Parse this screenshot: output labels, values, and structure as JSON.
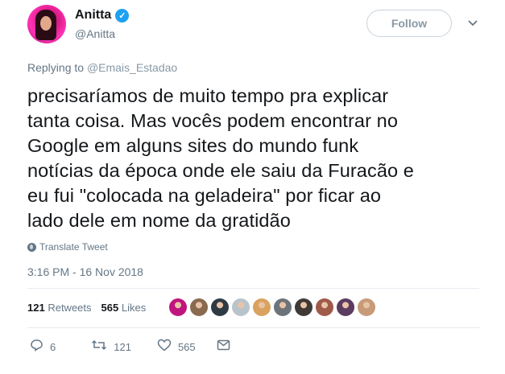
{
  "header": {
    "display_name": "Anitta",
    "handle": "@Anitta",
    "follow_label": "Follow"
  },
  "reply": {
    "prefix": "Replying to",
    "mention": "@Emais_Estadao"
  },
  "tweet": {
    "lines": [
      "precisaríamos de muito tempo pra explicar",
      "tanta coisa. Mas vocês podem encontrar no",
      "Google em alguns sites do mundo funk",
      "notícias da época onde ele saiu da Furacão e",
      "eu fui \"colocada na geladeira\" por ficar ao",
      "lado dele em nome da gratidão"
    ],
    "translate_label": "Translate Tweet",
    "timestamp": "3:16 PM - 16 Nov 2018"
  },
  "stats": {
    "retweets_count": "121",
    "retweets_label": "Retweets",
    "likes_count": "565",
    "likes_label": "Likes"
  },
  "actions": {
    "replies": "6",
    "retweets": "121",
    "likes": "565"
  },
  "colors": {
    "accent": "#1da1f2",
    "muted": "#657786",
    "text": "#14171a"
  },
  "likers": [
    {
      "color": "#c0157e"
    },
    {
      "color": "#8a6a4f"
    },
    {
      "color": "#2f3b44"
    },
    {
      "color": "#b8c4cc"
    },
    {
      "color": "#d9a25e"
    },
    {
      "color": "#6d7479"
    },
    {
      "color": "#3f3a36"
    },
    {
      "color": "#a05a4a"
    },
    {
      "color": "#5b3b5f"
    },
    {
      "color": "#c79a78"
    }
  ]
}
